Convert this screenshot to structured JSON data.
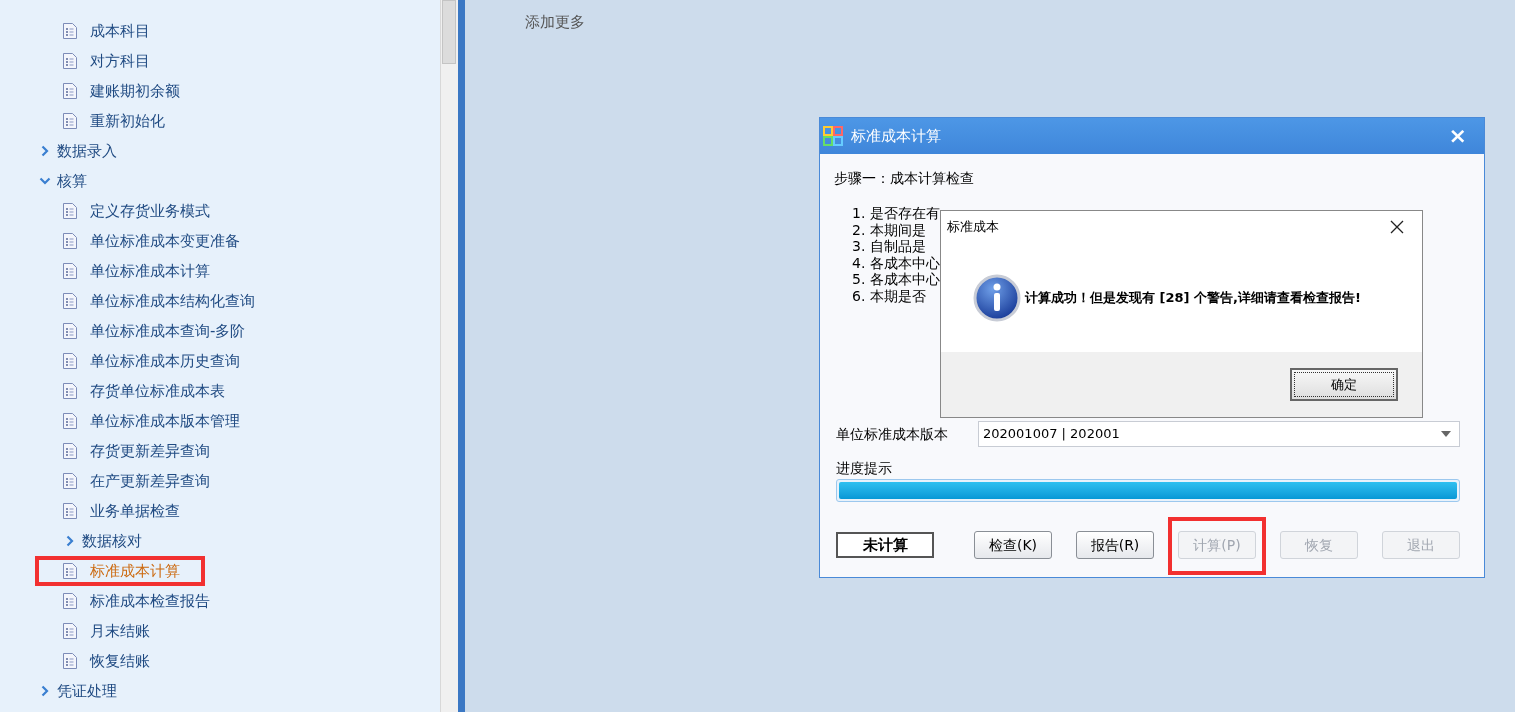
{
  "sidebar": {
    "tree": [
      {
        "kind": "leaf",
        "label": "成本科目",
        "selected": false,
        "highlighted": false
      },
      {
        "kind": "leaf",
        "label": "对方科目",
        "selected": false,
        "highlighted": false
      },
      {
        "kind": "leaf",
        "label": "建账期初余额",
        "selected": false,
        "highlighted": false
      },
      {
        "kind": "leaf",
        "label": "重新初始化",
        "selected": false,
        "highlighted": false
      },
      {
        "kind": "group",
        "label": "数据录入",
        "expanded": false,
        "selected": false
      },
      {
        "kind": "group",
        "label": "核算",
        "expanded": true,
        "selected": false,
        "children": [
          {
            "kind": "leaf",
            "label": "定义存货业务模式",
            "selected": false,
            "highlighted": false
          },
          {
            "kind": "leaf",
            "label": "单位标准成本变更准备",
            "selected": false,
            "highlighted": false
          },
          {
            "kind": "leaf",
            "label": "单位标准成本计算",
            "selected": false,
            "highlighted": false
          },
          {
            "kind": "leaf",
            "label": "单位标准成本结构化查询",
            "selected": false,
            "highlighted": false
          },
          {
            "kind": "leaf",
            "label": "单位标准成本查询-多阶",
            "selected": false,
            "highlighted": false
          },
          {
            "kind": "leaf",
            "label": "单位标准成本历史查询",
            "selected": false,
            "highlighted": false
          },
          {
            "kind": "leaf",
            "label": "存货单位标准成本表",
            "selected": false,
            "highlighted": false
          },
          {
            "kind": "leaf",
            "label": "单位标准成本版本管理",
            "selected": false,
            "highlighted": false
          },
          {
            "kind": "leaf",
            "label": "存货更新差异查询",
            "selected": false,
            "highlighted": false
          },
          {
            "kind": "leaf",
            "label": "在产更新差异查询",
            "selected": false,
            "highlighted": false
          },
          {
            "kind": "leaf",
            "label": "业务单据检查",
            "selected": false,
            "highlighted": false
          },
          {
            "kind": "group",
            "label": "数据核对",
            "expanded": false,
            "selected": false
          },
          {
            "kind": "leaf",
            "label": "标准成本计算",
            "selected": true,
            "highlighted": true
          },
          {
            "kind": "leaf",
            "label": "标准成本检查报告",
            "selected": false,
            "highlighted": false
          },
          {
            "kind": "leaf",
            "label": "月末结账",
            "selected": false,
            "highlighted": false
          },
          {
            "kind": "leaf",
            "label": "恢复结账",
            "selected": false,
            "highlighted": false
          }
        ]
      },
      {
        "kind": "group",
        "label": "凭证处理",
        "expanded": false,
        "selected": false
      }
    ]
  },
  "main": {
    "link": "添加更多"
  },
  "dialog": {
    "title": "标准成本计算",
    "close": "×",
    "step": "步骤一：成本计算检查",
    "checklist": [
      "1. 是否存在有",
      "2. 本期间是",
      "3. 自制品是",
      "4. 各成本中心",
      "5. 各成本中心",
      "6. 本期是否"
    ],
    "version_label": "单位标准成本版本",
    "version_value": "202001007 | 202001",
    "progress_label": "进度提示",
    "progress": {
      "level": 1
    },
    "status": "未计算",
    "buttons": [
      {
        "label": "检查(K)",
        "disabled": false,
        "highlighted": false
      },
      {
        "label": "报告(R)",
        "disabled": false,
        "highlighted": false
      },
      {
        "label": "计算(P)",
        "disabled": true,
        "highlighted": true
      },
      {
        "label": "恢复",
        "disabled": true,
        "highlighted": false
      },
      {
        "label": "退出",
        "disabled": true,
        "highlighted": false
      }
    ]
  },
  "message_box": {
    "title": "标准成本",
    "message": "计算成功！但是发现有 [28] 个警告,详细请查看检查报告!",
    "ok": "确定"
  }
}
